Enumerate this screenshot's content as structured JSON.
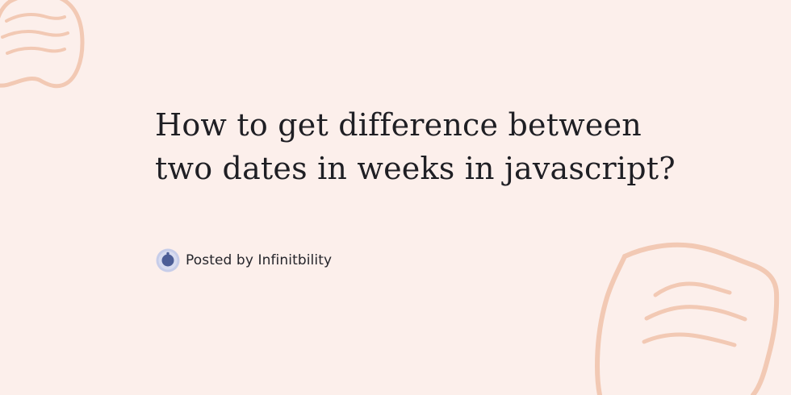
{
  "post": {
    "title_line_1": "How to get difference between",
    "title_line_2": "two dates in weeks in javascript?",
    "author_label": "Posted by Infinitbility"
  },
  "theme": {
    "background": "#fcefeb",
    "decor_stroke": "#f2c9b4",
    "text": "#1f1f24",
    "avatar_outer": "#c7cde9",
    "avatar_inner": "#4d5e97"
  },
  "icons": {
    "author_avatar": "avatar-icon",
    "top_left_decoration": "speech-bubble-doodle-icon",
    "bottom_right_decoration": "note-doodle-icon"
  }
}
